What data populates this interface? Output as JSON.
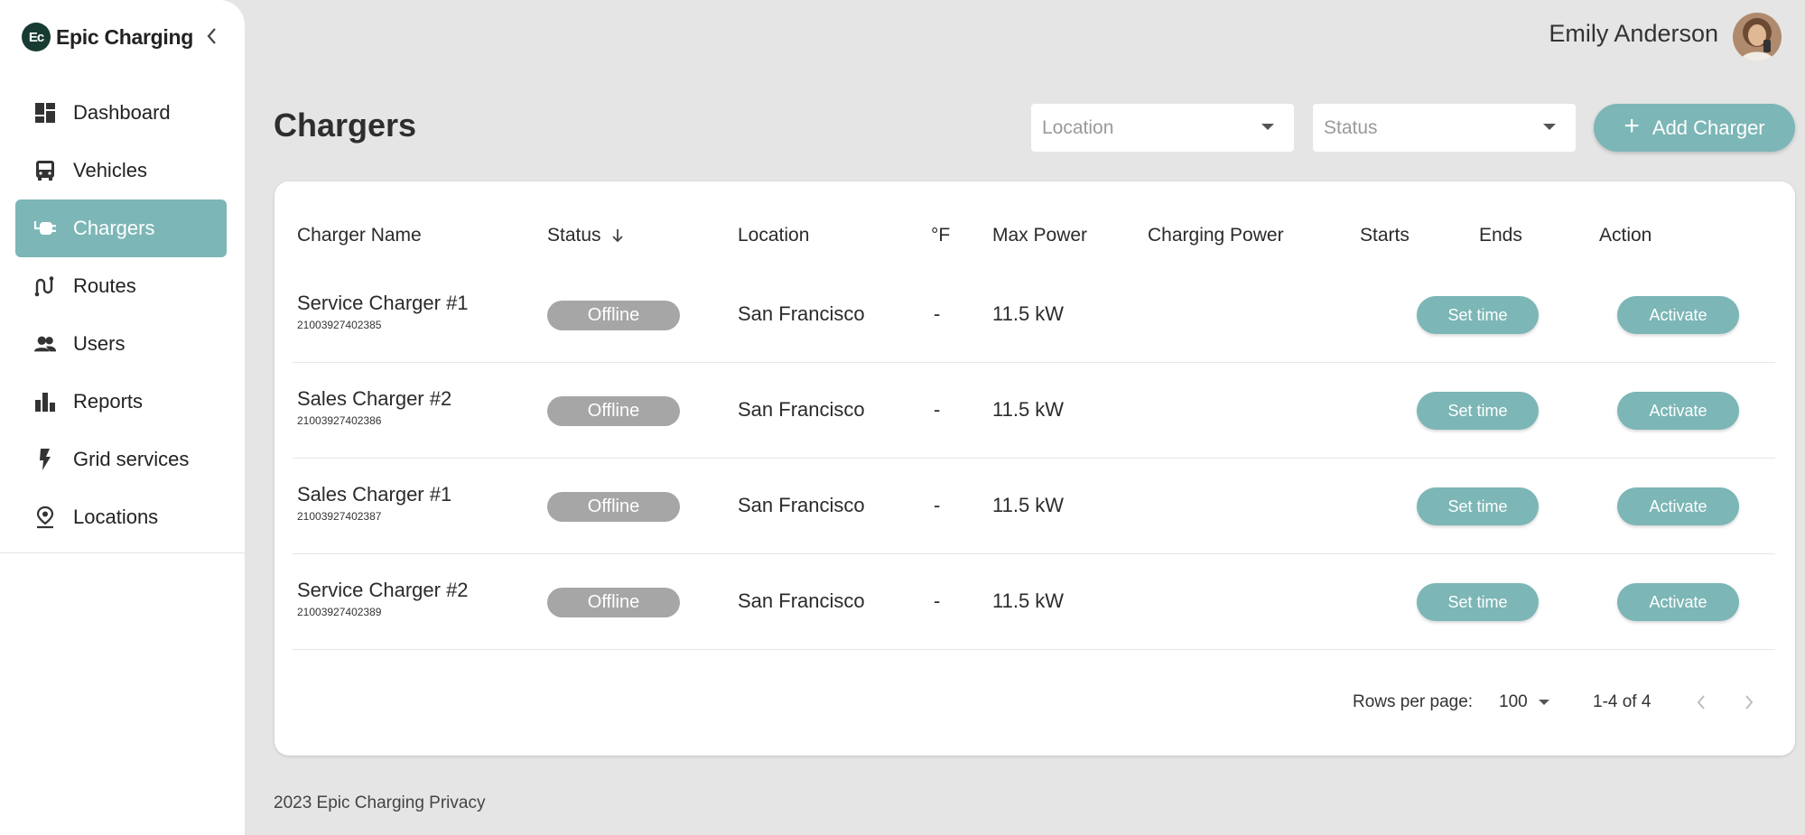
{
  "brand": {
    "logo_text": "Ec",
    "name": "Epic Charging"
  },
  "sidebar": {
    "items": [
      {
        "label": "Dashboard",
        "icon": "dashboard-icon",
        "active": false
      },
      {
        "label": "Vehicles",
        "icon": "bus-icon",
        "active": false
      },
      {
        "label": "Chargers",
        "icon": "ev-plug-icon",
        "active": true
      },
      {
        "label": "Routes",
        "icon": "route-icon",
        "active": false
      },
      {
        "label": "Users",
        "icon": "users-icon",
        "active": false
      },
      {
        "label": "Reports",
        "icon": "bar-chart-icon",
        "active": false
      },
      {
        "label": "Grid services",
        "icon": "bolt-icon",
        "active": false
      },
      {
        "label": "Locations",
        "icon": "location-pin-icon",
        "active": false
      }
    ]
  },
  "header": {
    "user_name": "Emily Anderson"
  },
  "page": {
    "title": "Chargers"
  },
  "filters": {
    "location_placeholder": "Location",
    "status_placeholder": "Status",
    "add_label": "Add Charger"
  },
  "table": {
    "columns": {
      "name": "Charger Name",
      "status": "Status",
      "location": "Location",
      "temp": "°F",
      "max_power": "Max Power",
      "charging_power": "Charging Power",
      "starts": "Starts",
      "ends": "Ends",
      "action": "Action"
    },
    "rows": [
      {
        "name": "Service Charger #1",
        "id": "21003927402385",
        "status": "Offline",
        "location": "San Francisco",
        "temp": "-",
        "max_power": "11.5 kW",
        "set_time": "Set time",
        "action": "Activate"
      },
      {
        "name": "Sales Charger #2",
        "id": "21003927402386",
        "status": "Offline",
        "location": "San Francisco",
        "temp": "-",
        "max_power": "11.5 kW",
        "set_time": "Set time",
        "action": "Activate"
      },
      {
        "name": "Sales Charger #1",
        "id": "21003927402387",
        "status": "Offline",
        "location": "San Francisco",
        "temp": "-",
        "max_power": "11.5 kW",
        "set_time": "Set time",
        "action": "Activate"
      },
      {
        "name": "Service Charger #2",
        "id": "21003927402389",
        "status": "Offline",
        "location": "San Francisco",
        "temp": "-",
        "max_power": "11.5 kW",
        "set_time": "Set time",
        "action": "Activate"
      }
    ]
  },
  "pagination": {
    "rows_label": "Rows per page:",
    "rows_value": "100",
    "range": "1-4 of 4"
  },
  "footer": {
    "text": "2023 Epic Charging Privacy"
  },
  "colors": {
    "accent": "#7cb6b6",
    "offline": "#a6a6a6",
    "brand_dark": "#173b32",
    "background": "#e5e5e5"
  }
}
